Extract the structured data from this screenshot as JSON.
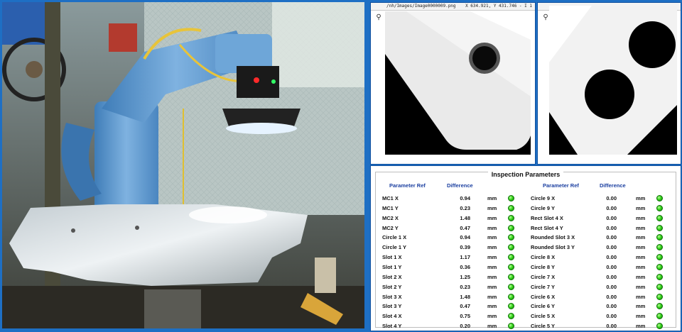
{
  "colors": {
    "frame": "#1e6fc4",
    "header_text": "#1b3fa0",
    "status_ok": "#37d41c"
  },
  "photo": {
    "subject": "robot-arm-vision-inspection"
  },
  "image_window_1": {
    "path": "/nh/Images/Image0000009.png",
    "coords": "X 634.921, Y 431.746 - I 1",
    "tool_icon": "zoom-icon"
  },
  "image_window_2": {
    "tool_icon": "zoom-icon"
  },
  "inspection": {
    "title": "Inspection Parameters",
    "headers": {
      "param": "Parameter Ref",
      "diff": "Difference"
    },
    "left": [
      {
        "name": "MC1 X",
        "value": "0.94",
        "unit": "mm",
        "status": "ok"
      },
      {
        "name": "MC1 Y",
        "value": "0.23",
        "unit": "mm",
        "status": "ok"
      },
      {
        "name": "MC2 X",
        "value": "1.48",
        "unit": "mm",
        "status": "ok"
      },
      {
        "name": "MC2 Y",
        "value": "0.47",
        "unit": "mm",
        "status": "ok"
      },
      {
        "name": "Circle 1 X",
        "value": "0.94",
        "unit": "mm",
        "status": "ok"
      },
      {
        "name": "Circle 1 Y",
        "value": "0.39",
        "unit": "mm",
        "status": "ok"
      },
      {
        "name": "Slot 1 X",
        "value": "1.17",
        "unit": "mm",
        "status": "ok"
      },
      {
        "name": "Slot 1 Y",
        "value": "0.36",
        "unit": "mm",
        "status": "ok"
      },
      {
        "name": "Slot 2 X",
        "value": "1.25",
        "unit": "mm",
        "status": "ok"
      },
      {
        "name": "Slot 2 Y",
        "value": "0.23",
        "unit": "mm",
        "status": "ok"
      },
      {
        "name": "Slot 3 X",
        "value": "1.48",
        "unit": "mm",
        "status": "ok"
      },
      {
        "name": "Slot 3 Y",
        "value": "0.47",
        "unit": "mm",
        "status": "ok"
      },
      {
        "name": "Slot 4 X",
        "value": "0.75",
        "unit": "mm",
        "status": "ok"
      },
      {
        "name": "Slot 4 Y",
        "value": "0.20",
        "unit": "mm",
        "status": "ok"
      }
    ],
    "right": [
      {
        "name": "Circle 9 X",
        "value": "0.00",
        "unit": "mm",
        "status": "ok"
      },
      {
        "name": "Circle 9 Y",
        "value": "0.00",
        "unit": "mm",
        "status": "ok"
      },
      {
        "name": "Rect Slot 4 X",
        "value": "0.00",
        "unit": "mm",
        "status": "ok"
      },
      {
        "name": "Rect Slot 4 Y",
        "value": "0.00",
        "unit": "mm",
        "status": "ok"
      },
      {
        "name": "Rounded Slot 3 X",
        "value": "0.00",
        "unit": "mm",
        "status": "ok"
      },
      {
        "name": "Rounded Slot 3 Y",
        "value": "0.00",
        "unit": "mm",
        "status": "ok"
      },
      {
        "name": "Circle 8 X",
        "value": "0.00",
        "unit": "mm",
        "status": "ok"
      },
      {
        "name": "Circle 8 Y",
        "value": "0.00",
        "unit": "mm",
        "status": "ok"
      },
      {
        "name": "Circle 7 X",
        "value": "0.00",
        "unit": "mm",
        "status": "ok"
      },
      {
        "name": "Circle 7 Y",
        "value": "0.00",
        "unit": "mm",
        "status": "ok"
      },
      {
        "name": "Circle 6 X",
        "value": "0.00",
        "unit": "mm",
        "status": "ok"
      },
      {
        "name": "Circle 6 Y",
        "value": "0.00",
        "unit": "mm",
        "status": "ok"
      },
      {
        "name": "Circle 5 X",
        "value": "0.00",
        "unit": "mm",
        "status": "ok"
      },
      {
        "name": "Circle 5 Y",
        "value": "0.00",
        "unit": "mm",
        "status": "ok"
      }
    ]
  }
}
